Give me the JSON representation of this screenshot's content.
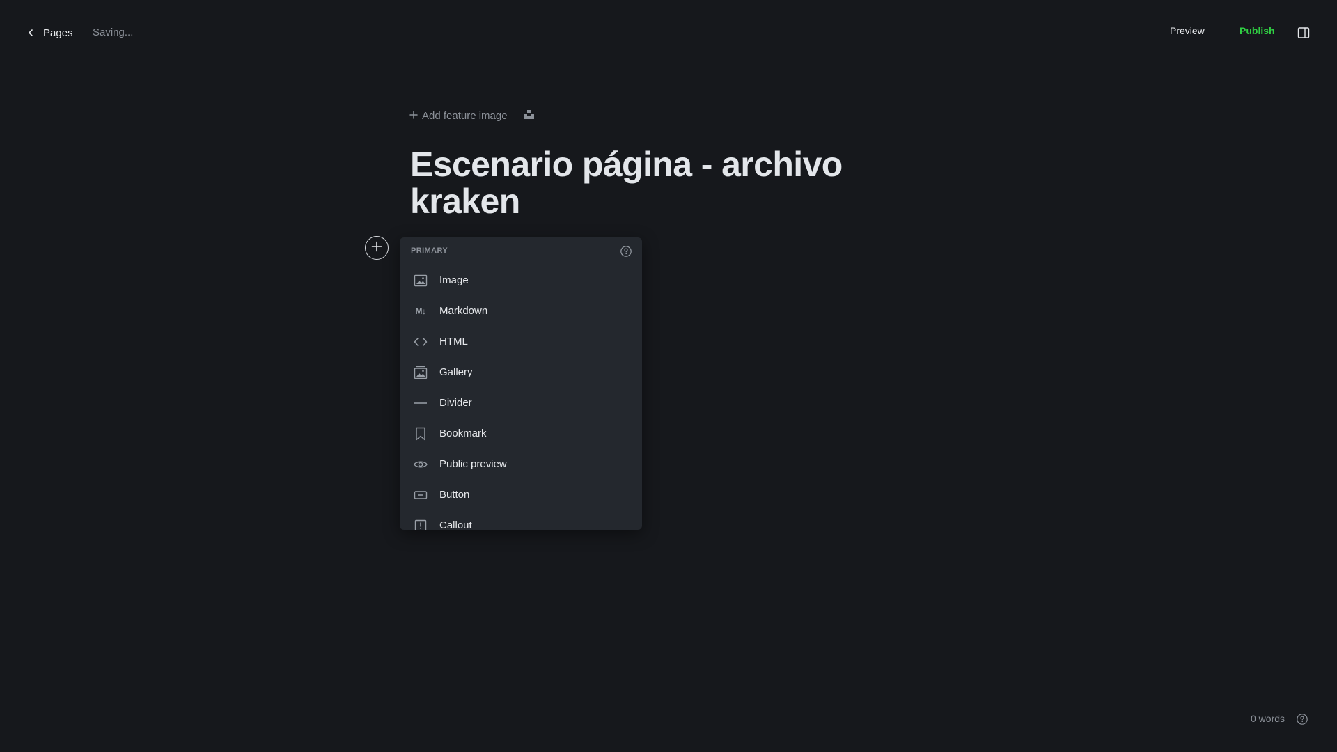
{
  "header": {
    "back_label": "Pages",
    "status": "Saving...",
    "preview_label": "Preview",
    "publish_label": "Publish",
    "publish_color": "#30cf43"
  },
  "editor": {
    "feature_image_label": "Add feature image",
    "title_line1": "Escenario página - archivo",
    "title_line2": "kraken"
  },
  "card_menu": {
    "section_label": "PRIMARY",
    "items": [
      {
        "label": "Image",
        "icon": "image-icon"
      },
      {
        "label": "Markdown",
        "icon": "markdown-icon",
        "icon_text": "M↓"
      },
      {
        "label": "HTML",
        "icon": "code-icon"
      },
      {
        "label": "Gallery",
        "icon": "gallery-icon"
      },
      {
        "label": "Divider",
        "icon": "divider-icon"
      },
      {
        "label": "Bookmark",
        "icon": "bookmark-icon"
      },
      {
        "label": "Public preview",
        "icon": "eye-icon"
      },
      {
        "label": "Button",
        "icon": "button-icon"
      },
      {
        "label": "Callout",
        "icon": "callout-icon"
      }
    ]
  },
  "footer": {
    "word_count": "0 words"
  }
}
